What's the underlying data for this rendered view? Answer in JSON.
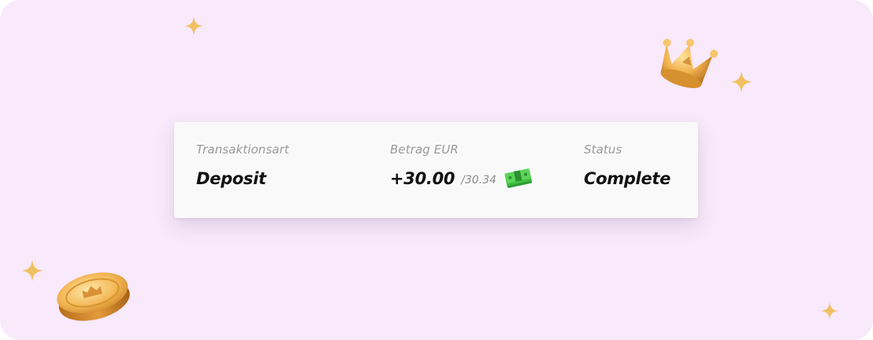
{
  "transaction": {
    "type_label": "Transaktionsart",
    "type_value": "Deposit",
    "amount_label": "Betrag EUR",
    "amount_value": "+30.00",
    "amount_sub": "/30.34",
    "status_label": "Status",
    "status_value": "Complete"
  },
  "icons": {
    "amount": "cash-stack-icon",
    "decorations": [
      "sparkle-icon",
      "crown-icon",
      "coin-icon"
    ]
  },
  "colors": {
    "background": "#f8e9fb",
    "card": "#f9f9f9",
    "gold": "#e9a94a",
    "cash": "#4ccf4a"
  }
}
